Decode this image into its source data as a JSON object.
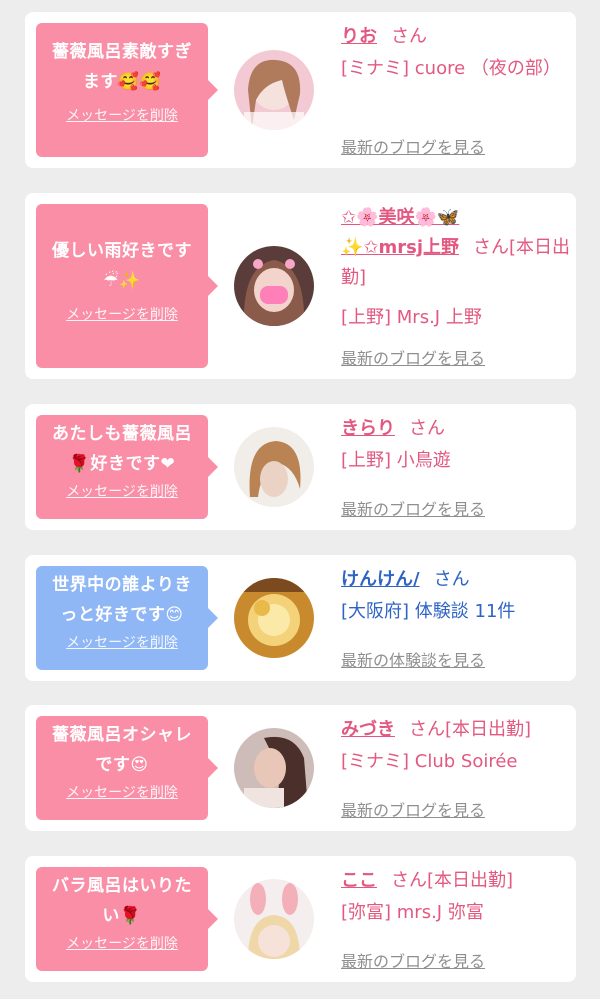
{
  "cards": [
    {
      "message_line1": "薔薇風呂素敵すぎ",
      "message_line2": "ます🥰🥰",
      "delete_label": "メッセージを削除",
      "name": "りお",
      "suffix": "さん",
      "shop": "[ミナミ] cuore （夜の部）",
      "blog_link": "最新のブログを見る"
    },
    {
      "message_line1": "優しい雨好きです",
      "message_line2": "☔✨",
      "delete_label": "メッセージを削除",
      "name_line1": "✩🌸美咲🌸🦋",
      "name_line2": "✨✩mrsj上野",
      "suffix": "さん[本日出勤]",
      "shop": "[上野] Mrs.J 上野",
      "blog_link": "最新のブログを見る"
    },
    {
      "message_line1": "あたしも薔薇風呂",
      "message_line2": "🌹好きです❤",
      "delete_label": "メッセージを削除",
      "name": "きらり",
      "suffix": "さん",
      "shop": "[上野] 小鳥遊",
      "blog_link": "最新のブログを見る"
    },
    {
      "message_line1": "世界中の誰よりき",
      "message_line2": "っと好きです😊",
      "delete_label": "メッセージを削除",
      "name": "けんけん/",
      "suffix": "さん",
      "shop": "[大阪府] 体験談 11件",
      "blog_link": "最新の体験談を見る"
    },
    {
      "message_line1": "薔薇風呂オシャレ",
      "message_line2": "です😍",
      "delete_label": "メッセージを削除",
      "name": "みづき",
      "suffix": "さん[本日出勤]",
      "shop": "[ミナミ] Club Soirée",
      "blog_link": "最新のブログを見る"
    },
    {
      "message_line1": "バラ風呂はいりた",
      "message_line2": "い🌹",
      "delete_label": "メッセージを削除",
      "name": "ここ",
      "suffix": "さん[本日出勤]",
      "shop": "[弥富] mrs.J 弥富",
      "blog_link": "最新のブログを見る"
    }
  ],
  "colors": {
    "pink_bubble": "#f98ea6",
    "blue_bubble": "#8fb6f5",
    "pink_text": "#e35880",
    "blue_text": "#2f64c6",
    "link_gray": "#8f8f8f"
  }
}
